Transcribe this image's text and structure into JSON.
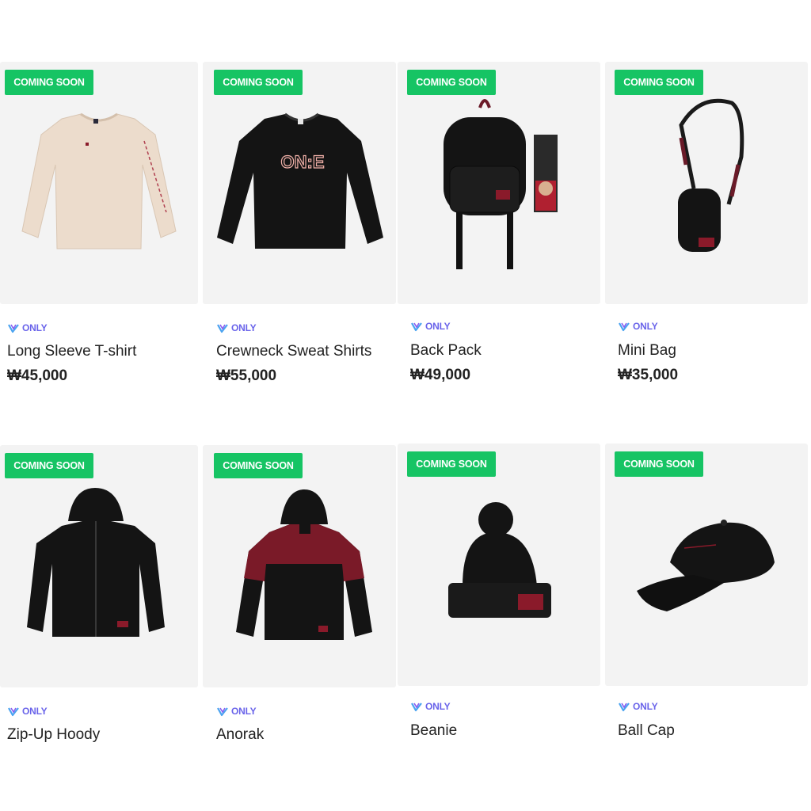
{
  "badge_text": "COMING SOON",
  "only_label": "ONLY",
  "colors": {
    "badge": "#16c464",
    "only_label": "#6a64ea",
    "tile_background": "#f3f3f3",
    "text": "#222222"
  },
  "products": [
    {
      "name": "Long Sleeve T-shirt",
      "price": "₩45,000",
      "image": "beige-long-sleeve-shirt"
    },
    {
      "name": "Crewneck Sweat Shirts",
      "price": "₩55,000",
      "image": "black-sweatshirt-one-logo"
    },
    {
      "name": "Back Pack",
      "price": "₩49,000",
      "image": "black-backpack"
    },
    {
      "name": "Mini Bag",
      "price": "₩35,000",
      "image": "black-mini-bag"
    },
    {
      "name": "Zip-Up Hoody",
      "price": "",
      "image": "black-zip-hoodie"
    },
    {
      "name": "Anorak",
      "price": "",
      "image": "black-red-anorak"
    },
    {
      "name": "Beanie",
      "price": "",
      "image": "black-beanie"
    },
    {
      "name": "Ball Cap",
      "price": "",
      "image": "black-ball-cap"
    }
  ],
  "logo_text": "ON:E"
}
